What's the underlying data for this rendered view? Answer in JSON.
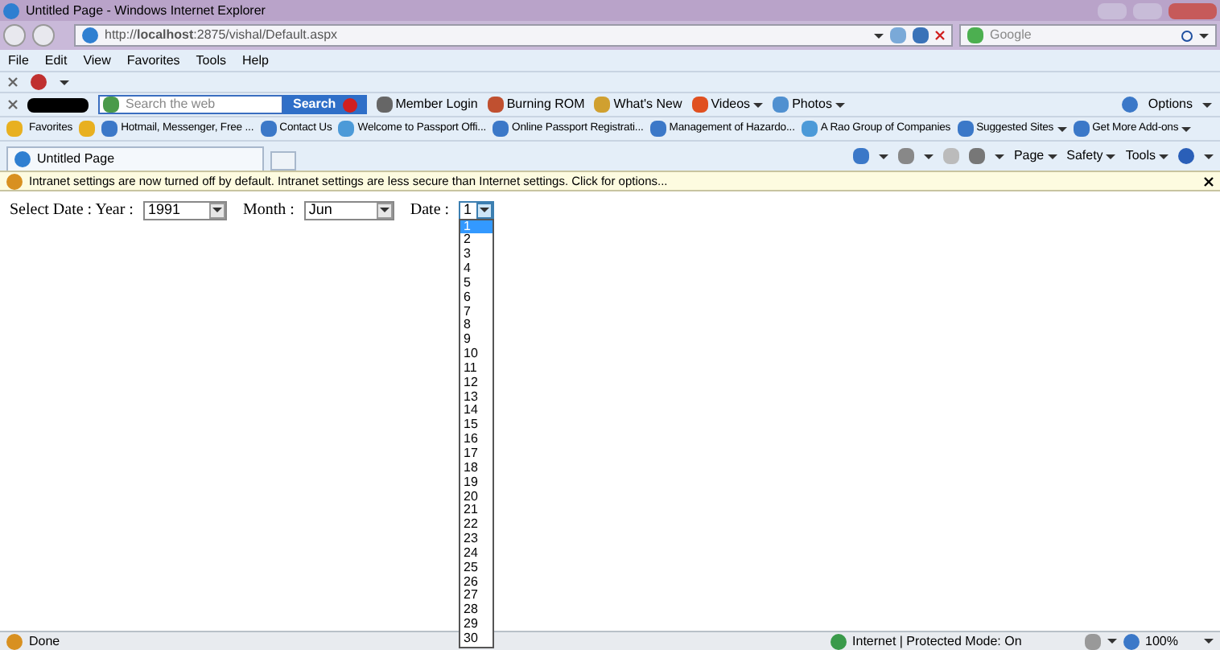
{
  "window": {
    "title": "Untitled Page - Windows Internet Explorer"
  },
  "address": {
    "url": "http://**localhost**:2875/vishal/Default.aspx"
  },
  "search": {
    "placeholder": "Google"
  },
  "menu": [
    "File",
    "Edit",
    "View",
    "Favorites",
    "Tools",
    "Help"
  ],
  "nero_bar": {
    "search_placeholder": "Search the web",
    "search_button": "Search",
    "links": [
      "Member Login",
      "Burning ROM",
      "What's New",
      "Videos",
      "Photos"
    ],
    "options": "Options"
  },
  "favorites_bar": {
    "label": "Favorites",
    "links": [
      "Hotmail, Messenger, Free ...",
      "Contact Us",
      "Welcome to Passport Offi...",
      "Online Passport Registrati...",
      "Management of Hazardo...",
      "A Rao Group of Companies",
      "Suggested Sites",
      "Get More Add-ons"
    ]
  },
  "tabs": [
    {
      "label": "Untitled Page",
      "selected": true
    }
  ],
  "command_bar": [
    "Page",
    "Safety",
    "Tools"
  ],
  "info_bar": {
    "text": "Intranet settings are now turned off by default. Intranet settings are less secure than Internet settings. Click for options..."
  },
  "form": {
    "label": "Select Date : Year :",
    "year": "1991",
    "month_label": "Month :",
    "month": "Jun",
    "date_label": "Date :",
    "date": "1",
    "date_expanded": true,
    "date_options": [
      {
        "label": "1",
        "selected": true
      },
      {
        "label": "2",
        "selected": false
      },
      {
        "label": "3",
        "selected": false
      },
      {
        "label": "4",
        "selected": false
      },
      {
        "label": "5",
        "selected": false
      },
      {
        "label": "6",
        "selected": false
      },
      {
        "label": "7",
        "selected": false
      },
      {
        "label": "8",
        "selected": false
      },
      {
        "label": "9",
        "selected": false
      },
      {
        "label": "10",
        "selected": false
      },
      {
        "label": "11",
        "selected": false
      },
      {
        "label": "12",
        "selected": false
      },
      {
        "label": "13",
        "selected": false
      },
      {
        "label": "14",
        "selected": false
      },
      {
        "label": "15",
        "selected": false
      },
      {
        "label": "16",
        "selected": false
      },
      {
        "label": "17",
        "selected": false
      },
      {
        "label": "18",
        "selected": false
      },
      {
        "label": "19",
        "selected": false
      },
      {
        "label": "20",
        "selected": false
      },
      {
        "label": "21",
        "selected": false
      },
      {
        "label": "22",
        "selected": false
      },
      {
        "label": "23",
        "selected": false
      },
      {
        "label": "24",
        "selected": false
      },
      {
        "label": "25",
        "selected": false
      },
      {
        "label": "26",
        "selected": false
      },
      {
        "label": "27",
        "selected": false
      },
      {
        "label": "28",
        "selected": false
      },
      {
        "label": "29",
        "selected": false
      },
      {
        "label": "30",
        "selected": false
      }
    ]
  },
  "status_bar": {
    "text": "Done",
    "zone": "Internet | Protected Mode: On",
    "zoom": "100%"
  }
}
